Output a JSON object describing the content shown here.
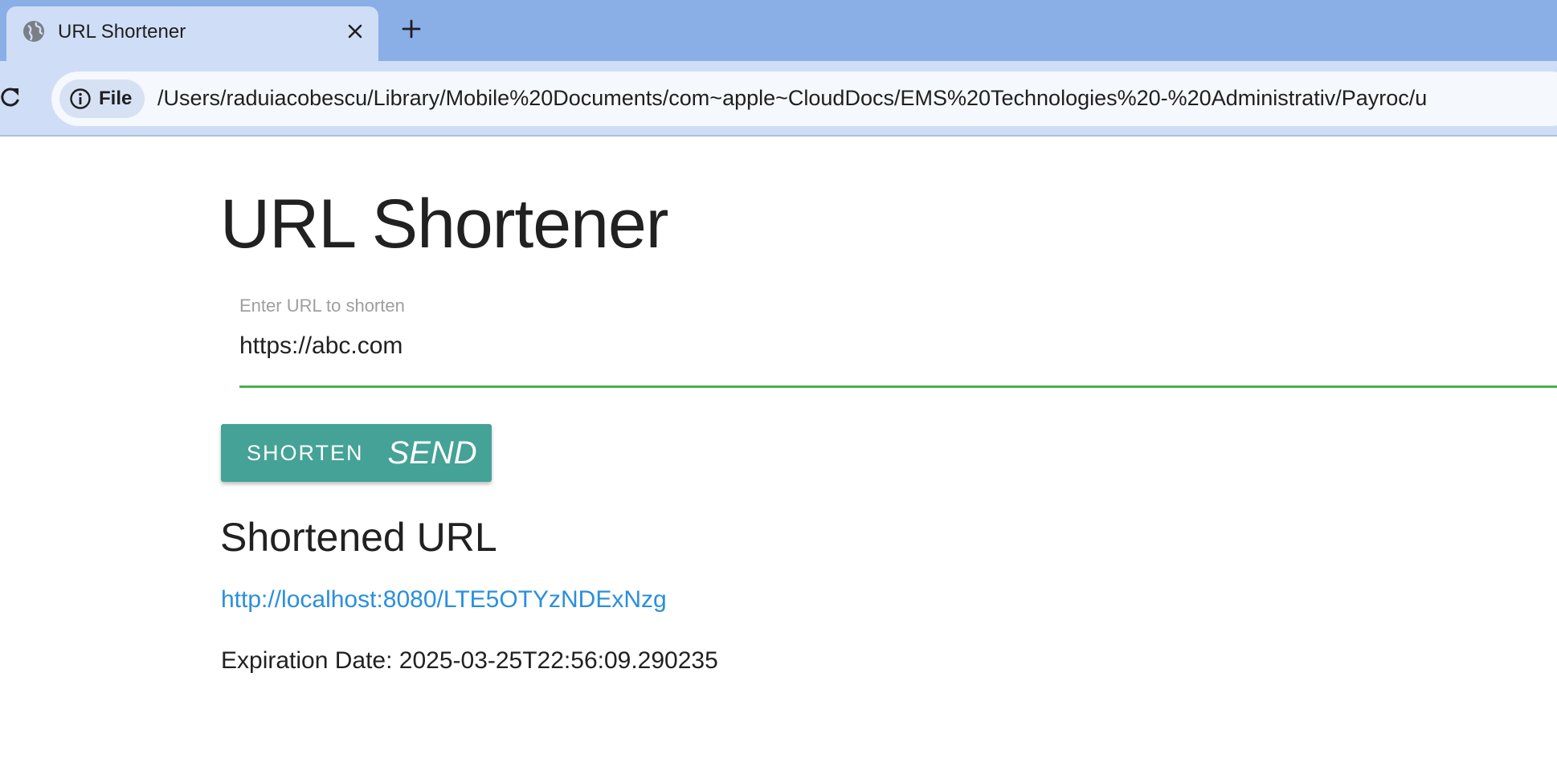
{
  "browser": {
    "tab": {
      "title": "URL Shortener",
      "favicon": "globe-icon",
      "close_icon": "close-icon"
    },
    "new_tab_icon": "plus-icon",
    "toolbar": {
      "reload_icon": "reload-icon",
      "site_info": {
        "icon": "info-icon",
        "label": "File"
      },
      "url": "/Users/raduiacobescu/Library/Mobile%20Documents/com~apple~CloudDocs/EMS%20Technologies%20-%20Administrativ/Payroc/u"
    }
  },
  "page": {
    "title": "URL Shortener",
    "url_field": {
      "label": "Enter URL to shorten",
      "value": "https://abc.com"
    },
    "shorten_button": {
      "label": "SHORTEN",
      "icon_text": "SEND"
    },
    "result": {
      "heading": "Shortened URL",
      "short_url": "http://localhost:8080/LTE5OTYzNDExNzg",
      "expiration": "Expiration Date: 2025-03-25T22:56:09.290235"
    }
  },
  "colors": {
    "tab_strip": "#8aaee6",
    "toolbar": "#cfdef6",
    "button": "#45a296",
    "field_underline": "#4caf50",
    "link": "#2a8fdc"
  }
}
